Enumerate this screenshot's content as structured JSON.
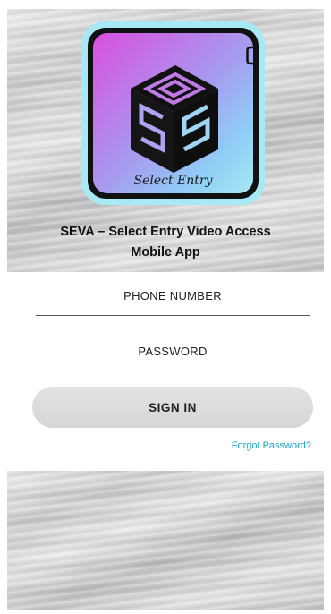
{
  "logo": {
    "caption": "Select Entry",
    "icon": "video-camera-icon",
    "colors": {
      "gradient_start": "#d94fe0",
      "gradient_end": "#a6e9f2",
      "frame": "#111111"
    }
  },
  "header": {
    "title_line1": "SEVA – Select Entry Video Access",
    "title_line2": "Mobile App"
  },
  "form": {
    "phone_placeholder": "PHONE NUMBER",
    "password_placeholder": "PASSWORD",
    "signin_label": "SIGN IN",
    "forgot_label": "Forgot Password?"
  },
  "colors": {
    "link": "#1aa6c6",
    "button": "#dcdcdc"
  }
}
